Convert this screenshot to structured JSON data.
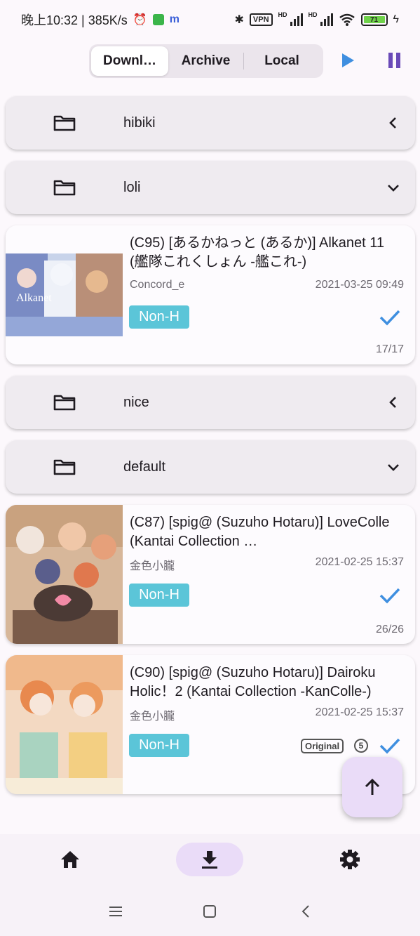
{
  "status_bar": {
    "time": "晚上10:32 | 385K/s",
    "battery": "71"
  },
  "tabs": [
    {
      "label": "Downl…",
      "active": true
    },
    {
      "label": "Archive",
      "active": false
    },
    {
      "label": "Local",
      "active": false
    }
  ],
  "colors": {
    "accent": "#6a4ab8",
    "play": "#3f8fe0",
    "tag": "#5bc5d8",
    "check": "#3f8fe0",
    "fab": "#eadcf8"
  },
  "folders": [
    {
      "name": "hibiki",
      "state": "collapsed"
    },
    {
      "name": "loli",
      "state": "expanded"
    },
    {
      "name": "nice",
      "state": "collapsed"
    },
    {
      "name": "default",
      "state": "expanded"
    }
  ],
  "items": [
    {
      "title": "(C95) [あるかねっと (あるか)] Alkanet 11 (艦隊これくしょん -艦これ-)",
      "uploader": "Concord_e",
      "date": "2021-03-25 09:49",
      "tag": "Non-H",
      "pages": "17/17"
    },
    {
      "title": "(C87) [spig@ (Suzuho Hotaru)] LoveColle (Kantai Collection …",
      "uploader": "金色小朧",
      "date": "2021-02-25 15:37",
      "tag": "Non-H",
      "pages": "26/26"
    },
    {
      "title": "(C90) [spig@ (Suzuho Hotaru)] Dairoku Holic！2 (Kantai Collection -KanColle-)",
      "uploader": "金色小朧",
      "date": "2021-02-25 15:37",
      "tag": "Non-H",
      "badge": "Original",
      "count": "5"
    }
  ],
  "icons": {
    "folder": "folder-icon",
    "play": "play-icon",
    "pause": "pause-icon",
    "check": "check-icon",
    "fab": "arrow-up-icon",
    "nav_home": "home-icon",
    "nav_download": "download-icon",
    "nav_settings": "gear-icon"
  }
}
